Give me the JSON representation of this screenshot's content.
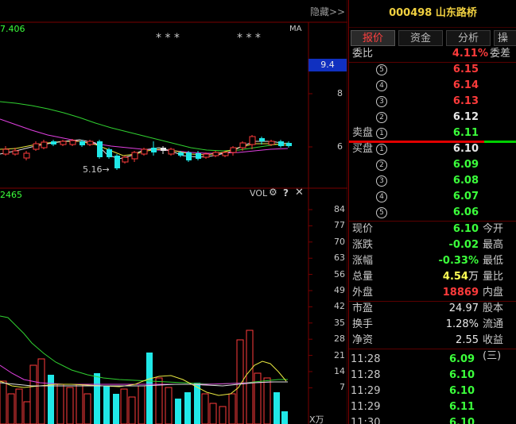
{
  "chart": {
    "hide_label": "隐藏>>",
    "price_top_label": "7.406",
    "ma_label": "MA",
    "stars_left": "* * *",
    "stars_right": "* * *",
    "low_label": "5.16→",
    "current_price_tag": "9.4",
    "price_ticks": [
      "8",
      "6"
    ],
    "vol_prefix": "2465",
    "vol_label": "VOL",
    "vol_ticks": [
      "84",
      "77",
      "70",
      "63",
      "56",
      "49",
      "42",
      "35",
      "28",
      "21",
      "14",
      "7"
    ],
    "vol_unit": "X万",
    "gear_icon": "gear-icon",
    "help_icon": "question-icon",
    "close_icon": "close-icon"
  },
  "panel": {
    "code": "000498",
    "name": "山东路桥",
    "tabs": [
      {
        "label": "报价"
      },
      {
        "label": "资金"
      },
      {
        "label": "分析"
      },
      {
        "label": "操"
      }
    ],
    "weibi": {
      "label": "委比",
      "value": "4.11%",
      "label2": "委差"
    },
    "sell_levels": [
      {
        "num": "5",
        "price": "6.15"
      },
      {
        "num": "4",
        "price": "6.14"
      },
      {
        "num": "3",
        "price": "6.13"
      },
      {
        "num": "2",
        "price": "6.12"
      },
      {
        "num": "1",
        "price": "6.11",
        "prefix": "卖盘"
      }
    ],
    "buy_levels": [
      {
        "num": "1",
        "price": "6.10",
        "prefix": "买盘"
      },
      {
        "num": "2",
        "price": "6.09"
      },
      {
        "num": "3",
        "price": "6.08"
      },
      {
        "num": "4",
        "price": "6.07"
      },
      {
        "num": "5",
        "price": "6.06"
      }
    ],
    "stats": [
      {
        "label": "现价",
        "value": "6.10",
        "label2": "今开",
        "color": "green"
      },
      {
        "label": "涨跌",
        "value": "-0.02",
        "label2": "最高",
        "color": "green"
      },
      {
        "label": "涨幅",
        "value": "-0.33%",
        "label2": "最低",
        "color": "green"
      },
      {
        "label": "总量",
        "value": "4.54",
        "unit": "万",
        "label2": "量比",
        "color": "yellow"
      },
      {
        "label": "外盘",
        "value": "18869",
        "label2": "内盘",
        "color": "red"
      }
    ],
    "stats2": [
      {
        "label": "市盈",
        "value": "24.97",
        "label2": "股本"
      },
      {
        "label": "换手",
        "value": "1.28%",
        "label2": "流通"
      },
      {
        "label": "净资",
        "value": "2.55",
        "label2": "收益(三)"
      }
    ],
    "ticks": [
      {
        "time": "11:28",
        "price": "6.09"
      },
      {
        "time": "11:28",
        "price": "6.10"
      },
      {
        "time": "11:29",
        "price": "6.10"
      },
      {
        "time": "11:29",
        "price": "6.11"
      },
      {
        "time": "11:30",
        "price": "6.10"
      }
    ]
  }
}
